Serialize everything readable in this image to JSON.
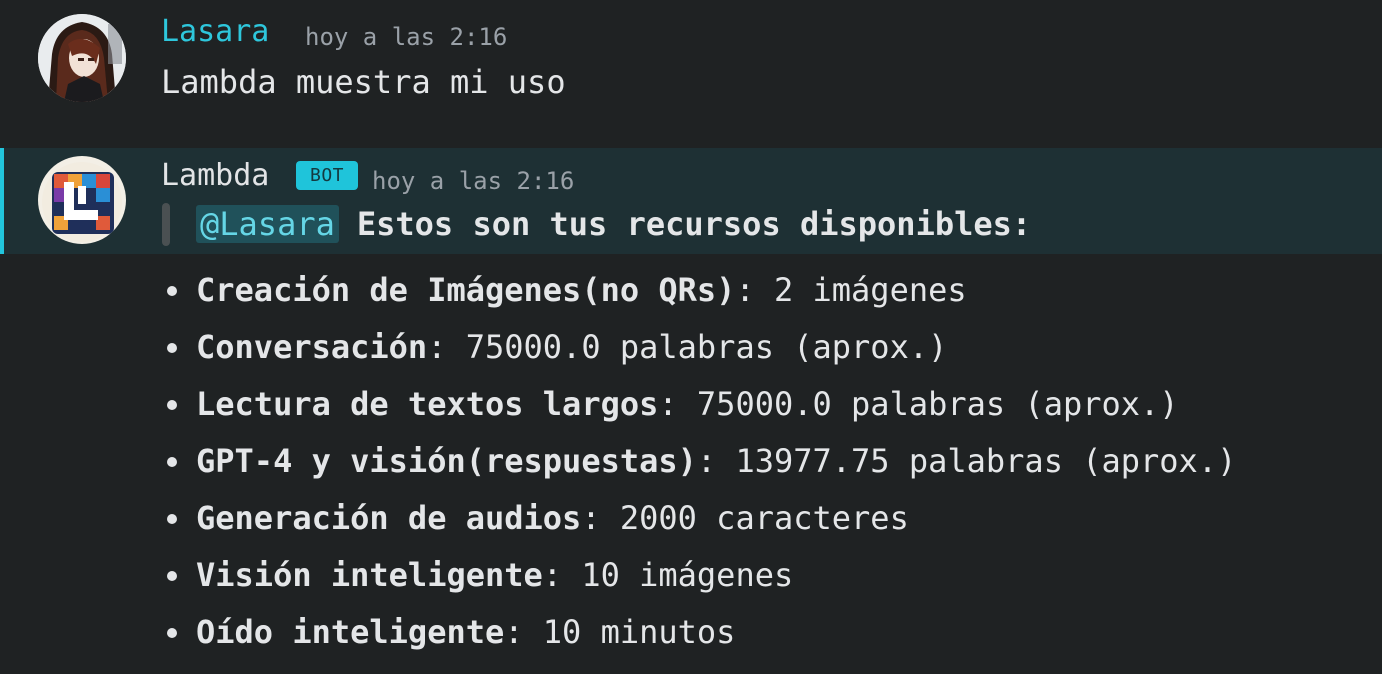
{
  "messages": {
    "user": {
      "name": "Lasara",
      "timestamp": "hoy a las 2:16",
      "content": "Lambda muestra mi uso"
    },
    "bot": {
      "name": "Lambda",
      "badge": "BOT",
      "timestamp": "hoy a las 2:16",
      "mention": "@Lasara",
      "quote": "Estos son tus recursos disponibles:",
      "items": [
        {
          "label": "Creación de Imágenes(no QRs)",
          "value": ": 2 imágenes"
        },
        {
          "label": "Conversación",
          "value": ": 75000.0 palabras (aprox.)"
        },
        {
          "label": "Lectura de textos largos",
          "value": ": 75000.0 palabras (aprox.)"
        },
        {
          "label": "GPT-4 y visión(respuestas)",
          "value": ": 13977.75 palabras (aprox.)"
        },
        {
          "label": "Generación de audios",
          "value": ": 2000 caracteres"
        },
        {
          "label": "Visión inteligente",
          "value": ": 10 imágenes"
        },
        {
          "label": "Oído inteligente",
          "value": ": 10 minutos"
        }
      ]
    }
  },
  "colors": {
    "background": "#1f2223",
    "highlight_background": "#1e3034",
    "accent": "#22c6dd",
    "user_name": "#2ec7dc",
    "mention_background": "#20515a",
    "mention_text": "#65d6e6"
  },
  "icons": {
    "user_avatar": "user-avatar-anime-portrait",
    "bot_avatar": "bot-avatar-lambda-logo"
  }
}
